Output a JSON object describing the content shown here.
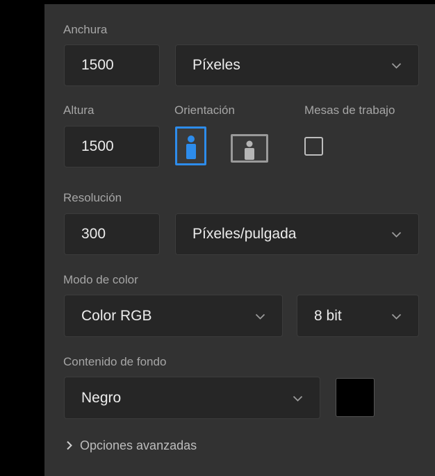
{
  "panel": {
    "width": {
      "label": "Anchura",
      "value": "1500",
      "unit": "Píxeles"
    },
    "height": {
      "label": "Altura",
      "value": "1500"
    },
    "orientation": {
      "label": "Orientación",
      "portrait_icon": "portrait-orientation-icon",
      "landscape_icon": "landscape-orientation-icon",
      "selected": "portrait"
    },
    "artboards": {
      "label": "Mesas de trabajo",
      "checked": false
    },
    "resolution": {
      "label": "Resolución",
      "value": "300",
      "unit": "Píxeles/pulgada"
    },
    "color_mode": {
      "label": "Modo de color",
      "mode": "Color RGB",
      "depth": "8 bit"
    },
    "background": {
      "label": "Contenido de fondo",
      "value": "Negro",
      "swatch_color": "#000000"
    },
    "advanced": {
      "label": "Opciones avanzadas",
      "icon": "chevron-right-icon"
    }
  },
  "colors": {
    "accent": "#2d8ceb",
    "panel_bg": "#323232",
    "field_bg": "#262626"
  }
}
